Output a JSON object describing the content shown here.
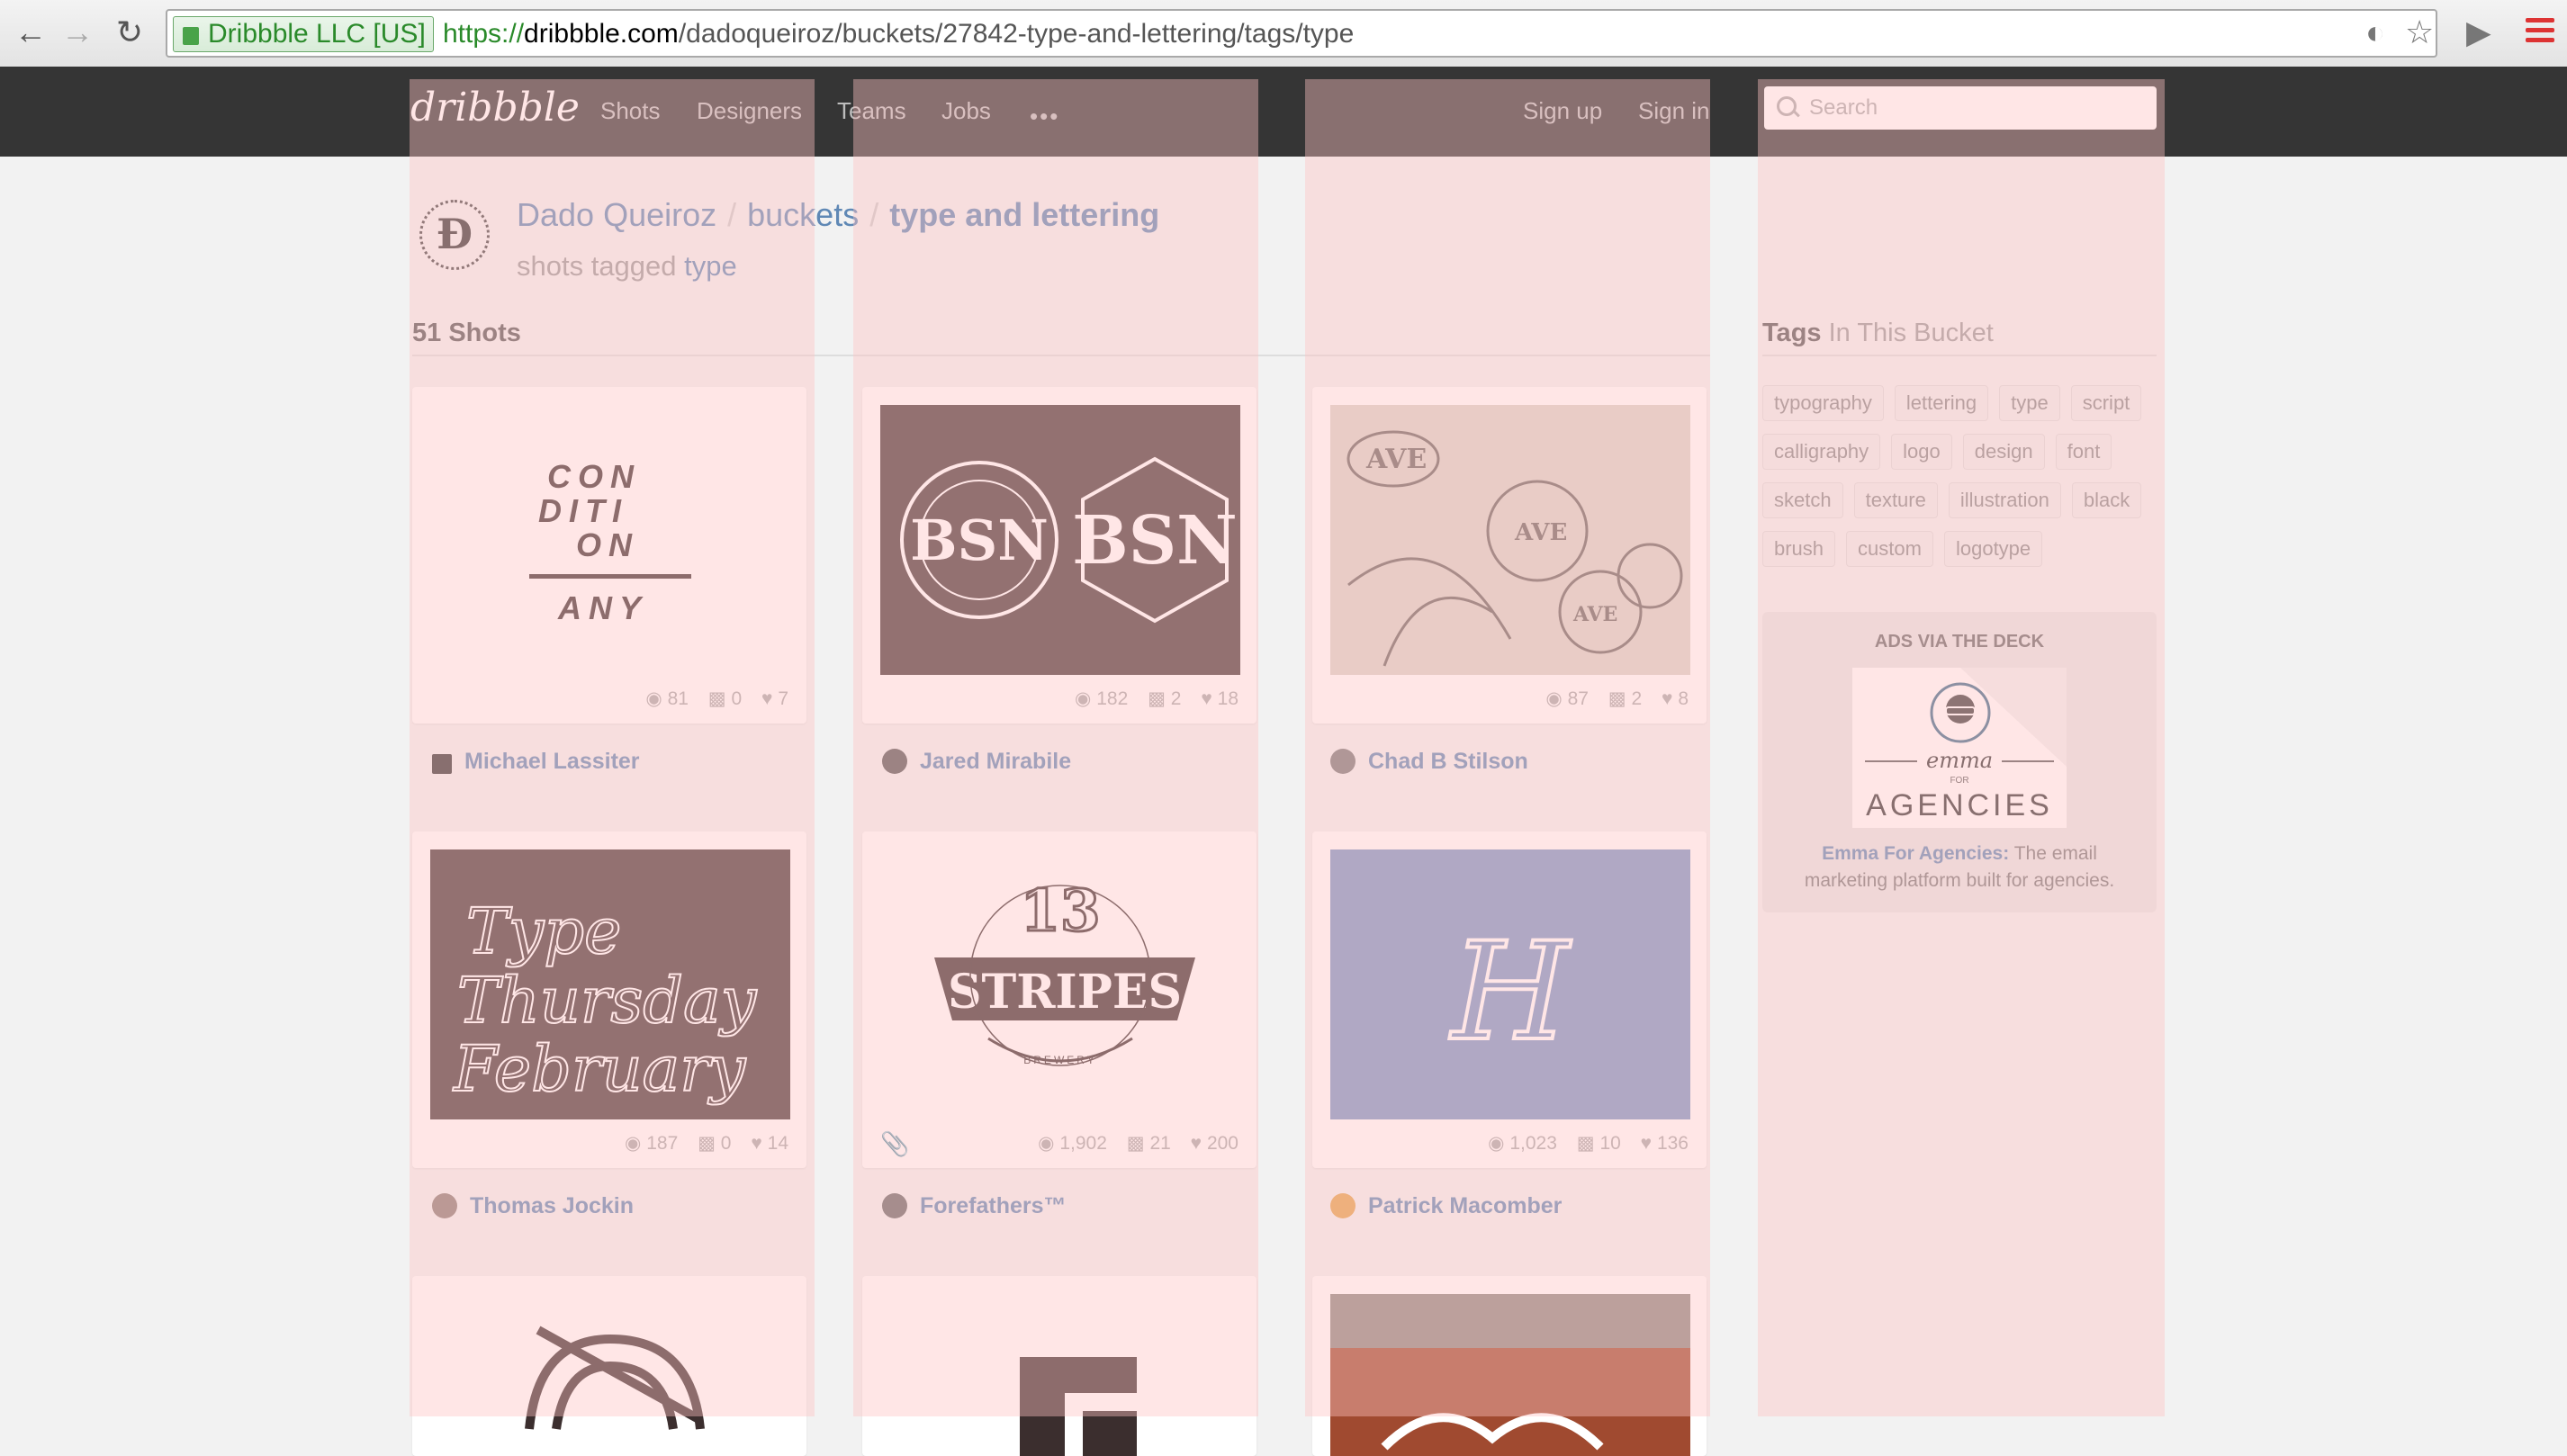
{
  "browser": {
    "ev_badge": "Dribbble LLC [US]",
    "url_protocol": "https://",
    "url_domain": "dribbble.com",
    "url_path": "/dadoqueiroz/buckets/27842-type-and-lettering/tags/type"
  },
  "header": {
    "logo": "dribbble",
    "nav": [
      "Shots",
      "Designers",
      "Teams",
      "Jobs"
    ],
    "more": "•••",
    "signup": "Sign up",
    "signin": "Sign in",
    "search_placeholder": "Search"
  },
  "profile": {
    "avatar_letter": "Đ",
    "owner": "Dado Queiroz",
    "sep": "/",
    "buckets": "buckets",
    "bucket_name": "type and lettering",
    "sub_prefix": "shots tagged",
    "tag": "type",
    "shot_count": "51 Shots"
  },
  "shots": [
    {
      "views": "81",
      "comments": "0",
      "likes": "7",
      "player": "Michael Lassiter",
      "art": "CON DITI ON / ANY CON"
    },
    {
      "views": "182",
      "comments": "2",
      "likes": "18",
      "player": "Jared Mirabile",
      "art": "BSN"
    },
    {
      "views": "87",
      "comments": "2",
      "likes": "8",
      "player": "Chad B Stilson",
      "art": "AVE"
    },
    {
      "views": "187",
      "comments": "0",
      "likes": "14",
      "player": "Thomas Jockin",
      "art_lines": [
        "Type",
        "Thursday",
        "February"
      ]
    },
    {
      "views": "1,902",
      "comments": "21",
      "likes": "200",
      "player": "Forefathers™",
      "art": "13 STRIPES"
    },
    {
      "views": "1,023",
      "comments": "10",
      "likes": "136",
      "player": "Patrick Macomber",
      "art": "H"
    }
  ],
  "sidebar": {
    "tags_bold": "Tags",
    "tags_rest": "In This Bucket",
    "tags": [
      "typography",
      "lettering",
      "type",
      "script",
      "calligraphy",
      "logo",
      "design",
      "font",
      "sketch",
      "texture",
      "illustration",
      "black",
      "brush",
      "custom",
      "logotype"
    ],
    "ad_heading": "ADS VIA THE DECK",
    "ad_brand": "emma",
    "ad_for": "FOR",
    "ad_tag": "AGENCIES",
    "ad_link": "Emma For Agencies:",
    "ad_text": "The email marketing platform built for agencies."
  },
  "colors": {
    "header_bg": "#353535",
    "link": "#5f88b5",
    "overlay": "#ffc3c3",
    "thumb_dark": "#463636",
    "thumb_blue": "#7894c4"
  }
}
